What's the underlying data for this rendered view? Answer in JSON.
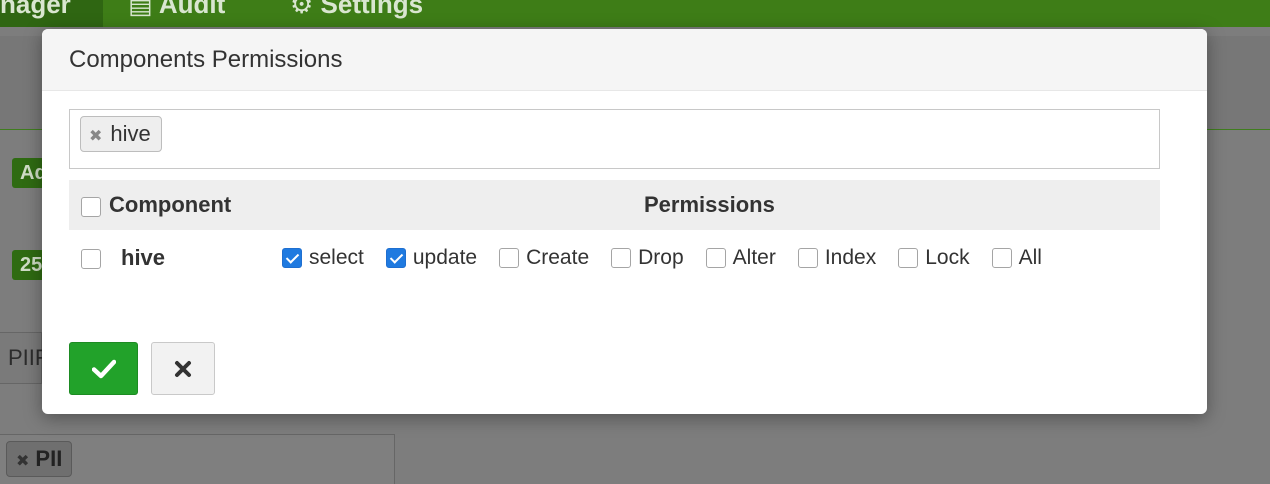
{
  "background": {
    "tabs": [
      {
        "label": "nager"
      },
      {
        "label": "▤ Audit"
      },
      {
        "label": "⚙ Settings"
      }
    ],
    "badges": [
      "Ad",
      "25"
    ],
    "box_text": "PIIF",
    "tag_label": "PII"
  },
  "modal": {
    "title": "Components Permissions",
    "selected_tags": [
      {
        "label": "hive"
      }
    ],
    "table": {
      "headers": {
        "component": "Component",
        "permissions": "Permissions"
      },
      "rows": [
        {
          "component": "hive",
          "permissions": [
            {
              "label": "select",
              "checked": true
            },
            {
              "label": "update",
              "checked": true
            },
            {
              "label": "Create",
              "checked": false
            },
            {
              "label": "Drop",
              "checked": false
            },
            {
              "label": "Alter",
              "checked": false
            },
            {
              "label": "Index",
              "checked": false
            },
            {
              "label": "Lock",
              "checked": false
            },
            {
              "label": "All",
              "checked": false
            }
          ]
        }
      ]
    },
    "buttons": {
      "ok_icon": "check-icon",
      "cancel_icon": "close-icon"
    }
  },
  "colors": {
    "accent": "#22a22a",
    "checkbox_checked": "#1f7ae0",
    "nav_green": "#3e7d17"
  }
}
